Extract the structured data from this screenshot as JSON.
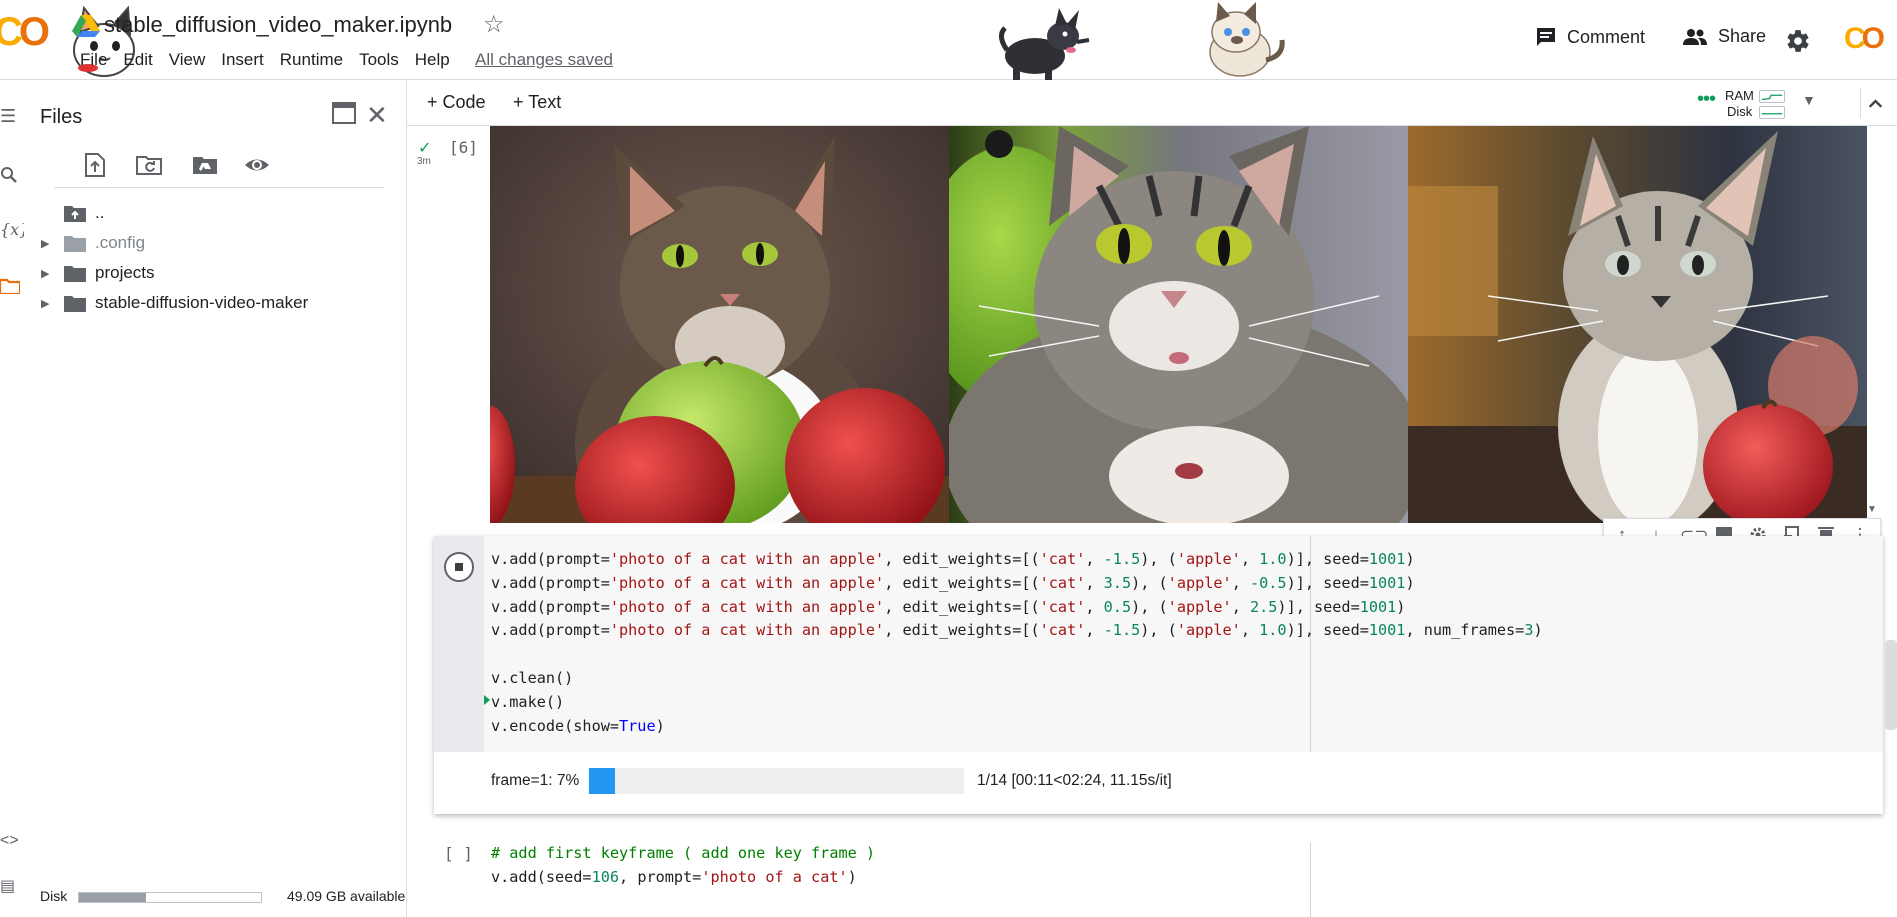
{
  "header": {
    "doc_title": "stable_diffusion_video_maker.ipynb",
    "saved_status": "All changes saved",
    "menu": [
      "File",
      "Edit",
      "View",
      "Insert",
      "Runtime",
      "Tools",
      "Help"
    ],
    "comment_label": "Comment",
    "share_label": "Share",
    "logo_text": "CO"
  },
  "files_panel": {
    "title": "Files",
    "tree": [
      {
        "label": "..",
        "dim": false,
        "caret": false,
        "icon": "folder-up-icon"
      },
      {
        "label": ".config",
        "dim": true,
        "caret": true,
        "icon": "folder-icon"
      },
      {
        "label": "projects",
        "dim": false,
        "caret": true,
        "icon": "folder-icon"
      },
      {
        "label": "stable-diffusion-video-maker",
        "dim": false,
        "caret": true,
        "icon": "folder-icon"
      }
    ],
    "disk": {
      "label": "Disk",
      "available": "49.09 GB available",
      "used_fraction": 0.37
    }
  },
  "toolbar": {
    "add_code": "+ Code",
    "add_text": "+ Text",
    "ram_label": "RAM",
    "disk_label": "Disk"
  },
  "cell6": {
    "exec_count": "[6]",
    "elapsed": "3m"
  },
  "running_cell": {
    "code_html": [
      "v.add(prompt=<span class=\"s\">'photo of a cat with an apple'</span>, edit_weights=[(<span class=\"s\">'cat'</span>, <span class=\"n\">-1.5</span>), (<span class=\"s\">'apple'</span>, <span class=\"n\">1.0</span>)], seed=<span class=\"n\">1001</span>)",
      "v.add(prompt=<span class=\"s\">'photo of a cat with an apple'</span>, edit_weights=[(<span class=\"s\">'cat'</span>, <span class=\"n\">3.5</span>), (<span class=\"s\">'apple'</span>, <span class=\"n\">-0.5</span>)], seed=<span class=\"n\">1001</span>)",
      "v.add(prompt=<span class=\"s\">'photo of a cat with an apple'</span>, edit_weights=[(<span class=\"s\">'cat'</span>, <span class=\"n\">0.5</span>), (<span class=\"s\">'apple'</span>, <span class=\"n\">2.5</span>)], seed=<span class=\"n\">1001</span>)",
      "v.add(prompt=<span class=\"s\">'photo of a cat with an apple'</span>, edit_weights=[(<span class=\"s\">'cat'</span>, <span class=\"n\">-1.5</span>), (<span class=\"s\">'apple'</span>, <span class=\"n\">1.0</span>)], seed=<span class=\"n\">1001</span>, num_frames=<span class=\"n\">3</span>)",
      "",
      "v.clean()",
      "v.make()",
      "v.encode(show=<span class=\"k\">True</span>)"
    ],
    "progress": {
      "label": "frame=1: 7%",
      "fraction": 0.07,
      "stats": "1/14 [00:11<02:24, 11.15s/it]"
    }
  },
  "next_cell": {
    "exec_count": "[ ]",
    "code_html": [
      "<span class=\"c\"># add first keyframe ( add one key frame )</span>",
      "v.add(seed=<span class=\"n\">106</span>, prompt=<span class=\"s\">'photo of a cat'</span>)"
    ]
  },
  "colors": {
    "colab_orange": "#f9ab00",
    "colab_orange_dark": "#e8710a",
    "progress_blue": "#2196f3",
    "success_green": "#0f9d58"
  }
}
